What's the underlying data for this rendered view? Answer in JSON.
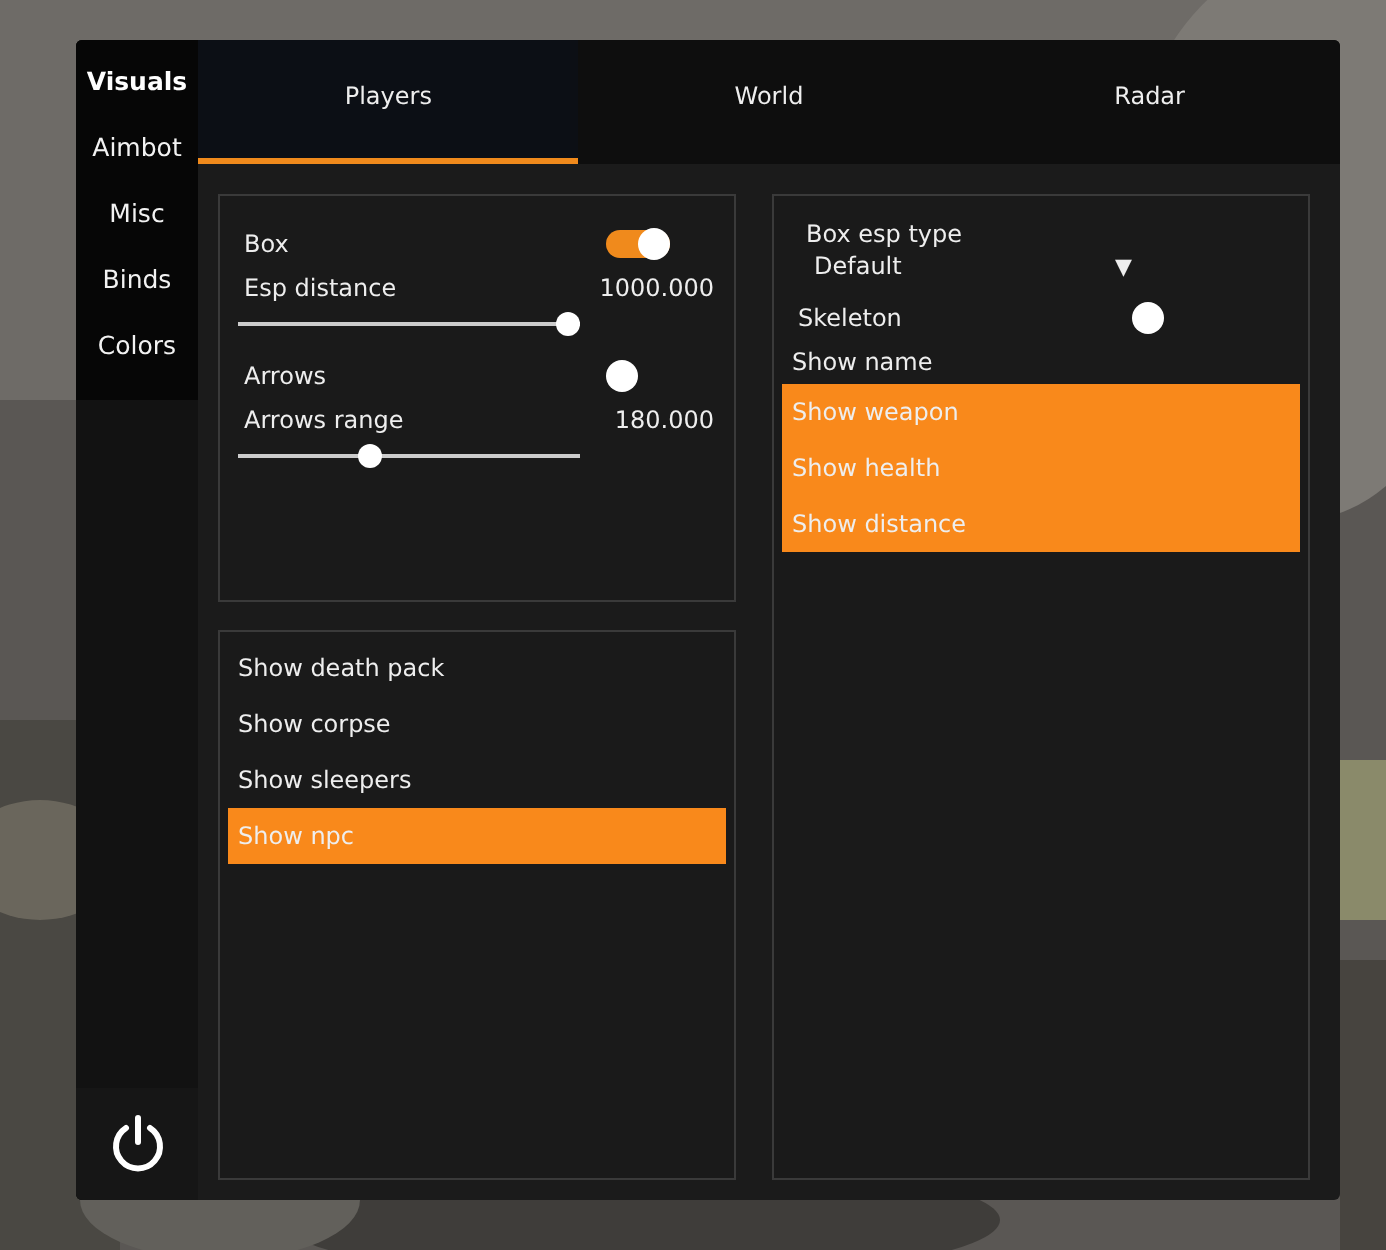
{
  "sidebar": {
    "items": [
      {
        "label": "Visuals",
        "selected": true
      },
      {
        "label": "Aimbot",
        "selected": false
      },
      {
        "label": "Misc",
        "selected": false
      },
      {
        "label": "Binds",
        "selected": false
      },
      {
        "label": "Colors",
        "selected": false
      }
    ]
  },
  "tabs": [
    {
      "label": "Players",
      "selected": true
    },
    {
      "label": "World",
      "selected": false
    },
    {
      "label": "Radar",
      "selected": false
    }
  ],
  "settings_panel": {
    "rows": [
      {
        "kind": "toggle",
        "label": "Box",
        "on": true
      },
      {
        "kind": "slider",
        "label": "Esp distance",
        "value": "1000.000",
        "level": 1.0
      },
      {
        "kind": "toggle",
        "label": "Arrows",
        "on": false
      },
      {
        "kind": "slider",
        "label": "Arrows range",
        "value": "180.000",
        "level": 0.38
      }
    ]
  },
  "object_list": {
    "items": [
      {
        "label": "Show death pack",
        "selected": false
      },
      {
        "label": "Show corpse",
        "selected": false
      },
      {
        "label": "Show sleepers",
        "selected": false
      },
      {
        "label": "Show npc",
        "selected": true
      }
    ]
  },
  "esp_panel": {
    "dropdown": {
      "label": "Box esp type",
      "value": "Default",
      "arrow": "▼"
    },
    "skeleton": {
      "label": "Skeleton",
      "on": false
    },
    "items": [
      {
        "label": "Show name",
        "selected": false
      },
      {
        "label": "Show weapon",
        "selected": true
      },
      {
        "label": "Show health",
        "selected": true
      },
      {
        "label": "Show distance",
        "selected": true
      }
    ]
  }
}
